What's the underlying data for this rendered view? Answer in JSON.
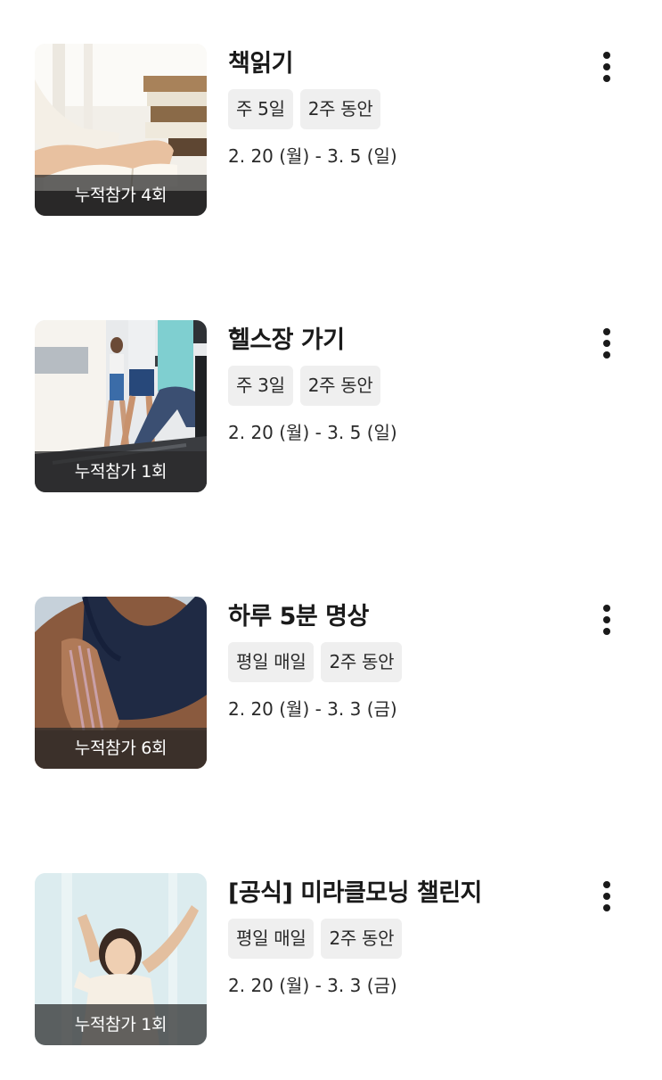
{
  "challenges": [
    {
      "title": "책읽기",
      "tags": [
        "주 5일",
        "2주 동안"
      ],
      "dates": "2. 20 (월) - 3. 5 (일)",
      "participation": "누적참가 4회",
      "image": "reading-book-photo"
    },
    {
      "title": "헬스장 가기",
      "tags": [
        "주 3일",
        "2주 동안"
      ],
      "dates": "2. 20 (월) - 3. 5 (일)",
      "participation": "누적참가 1회",
      "image": "gym-treadmill-photo"
    },
    {
      "title": "하루 5분 명상",
      "tags": [
        "평일 매일",
        "2주 동안"
      ],
      "dates": "2. 20 (월) - 3. 3 (금)",
      "participation": "누적참가 6회",
      "image": "meditation-photo"
    },
    {
      "title": "[공식] 미라클모닝 챌린지",
      "tags": [
        "평일 매일",
        "2주 동안"
      ],
      "dates": "2. 20 (월) - 3. 3 (금)",
      "participation": "누적참가 1회",
      "image": "morning-stretch-photo"
    }
  ],
  "colors": {
    "tag_background": "#efefef",
    "overlay": "#282828",
    "text": "#1a1a1a"
  },
  "icons": {
    "more": "more-vertical-icon"
  }
}
